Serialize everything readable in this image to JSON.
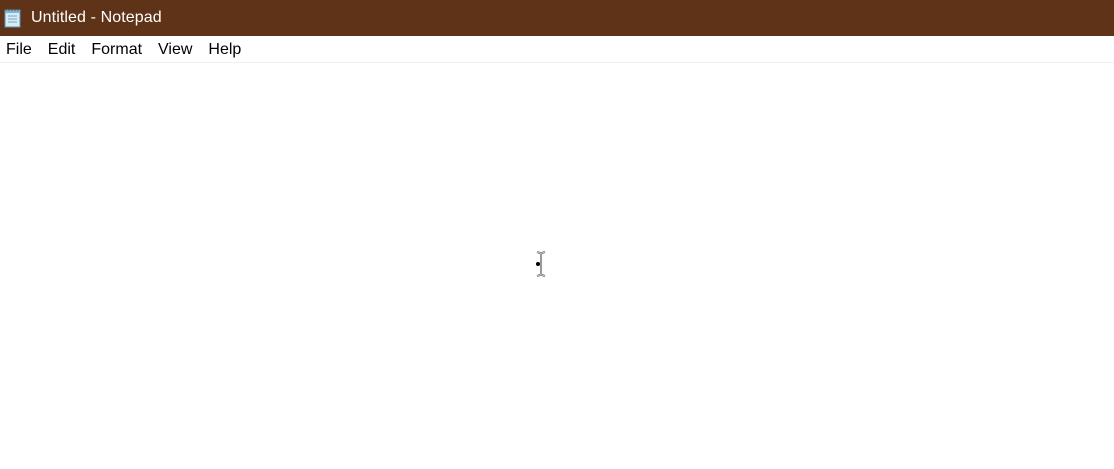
{
  "window": {
    "title": "Untitled - Notepad",
    "titlebar_color": "#5e3318",
    "icon": "notepad-icon"
  },
  "menu": {
    "items": [
      {
        "label": "File"
      },
      {
        "label": "Edit"
      },
      {
        "label": "Format"
      },
      {
        "label": "View"
      },
      {
        "label": "Help"
      }
    ]
  },
  "editor": {
    "content": "",
    "cursor_icon": "text-cursor-icon"
  }
}
